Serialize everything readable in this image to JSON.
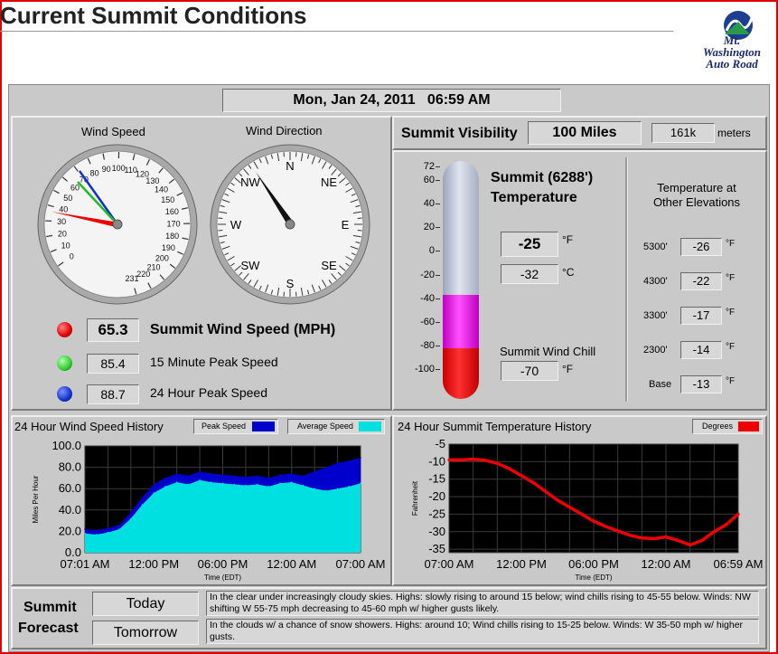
{
  "page_title": "Current Summit Conditions",
  "logo": {
    "line1": "Mt.",
    "line2": "Washington",
    "line3": "Auto Road"
  },
  "datetime": "Mon, Jan 24, 2011   06:59 AM",
  "gauges": {
    "wind_speed_title": "Wind Speed",
    "wind_direction_title": "Wind Direction",
    "speed_ticks": [
      "0",
      "10",
      "20",
      "30",
      "40",
      "50",
      "60",
      "70",
      "80",
      "90",
      "100",
      "110",
      "120",
      "130",
      "140",
      "150",
      "160",
      "170",
      "180",
      "190",
      "200",
      "210",
      "220",
      "231"
    ],
    "direction_labels": [
      "N",
      "NE",
      "E",
      "SE",
      "S",
      "SW",
      "W",
      "NW"
    ]
  },
  "wind": {
    "summit_value": "65.3",
    "summit_label": "Summit Wind Speed (MPH)",
    "peak15_value": "85.4",
    "peak15_label": "15 Minute Peak Speed",
    "peak24_value": "88.7",
    "peak24_label": "24 Hour Peak Speed",
    "led_colors": {
      "summit": "#e00000",
      "peak15": "#33cc33",
      "peak24": "#1133cc"
    }
  },
  "visibility": {
    "label": "Summit Visibility",
    "miles": "100 Miles",
    "meters_value": "161k",
    "meters_unit": "meters"
  },
  "temperature": {
    "title_line1": "Summit (6288')",
    "title_line2": "Temperature",
    "fahrenheit": "-25",
    "f_unit": "°F",
    "celsius": "-32",
    "c_unit": "°C",
    "scale": [
      "72",
      "60",
      "40",
      "20",
      "0",
      "-20",
      "-40",
      "-60",
      "-80",
      "-100"
    ],
    "wind_chill_label": "Summit Wind Chill",
    "wind_chill_value": "-70",
    "wind_chill_unit": "°F"
  },
  "elevations": {
    "title_line1": "Temperature at",
    "title_line2": "Other Elevations",
    "rows": [
      {
        "label": "5300'",
        "value": "-26",
        "unit": "°F"
      },
      {
        "label": "4300'",
        "value": "-22",
        "unit": "°F"
      },
      {
        "label": "3300'",
        "value": "-17",
        "unit": "°F"
      },
      {
        "label": "2300'",
        "value": "-14",
        "unit": "°F"
      },
      {
        "label": "Base",
        "value": "-13",
        "unit": "°F"
      }
    ]
  },
  "wind_history": {
    "title": "24 Hour Wind Speed History",
    "legend_peak": "Peak Speed",
    "legend_avg": "Average Speed"
  },
  "temp_history": {
    "title": "24 Hour Summit Temperature History",
    "legend": "Degrees"
  },
  "forecast": {
    "label_line1": "Summit",
    "label_line2": "Forecast",
    "today_label": "Today",
    "tomorrow_label": "Tomorrow",
    "today_text": "In the clear under increasingly cloudy skies.  Highs: slowly rising to around 15 below; wind chills rising to 45-55 below.  Winds: NW shifting W 55-75 mph decreasing to 45-60 mph w/ higher gusts likely.",
    "tomorrow_text": "In the clouds w/ a chance of snow showers.  Highs: around 10; Wind chills rising to 15-25 below.  Winds: W 35-50 mph w/ higher gusts."
  },
  "chart_data": [
    {
      "type": "area",
      "title": "24 Hour Wind Speed History",
      "xlabel": "Time (EDT)",
      "ylabel": "Miles Per Hour",
      "x_ticks": [
        "07:01 AM",
        "12:00 PM",
        "06:00 PM",
        "12:00 AM",
        "07:00 AM"
      ],
      "y_ticks": [
        "0.0",
        "20.0",
        "40.0",
        "60.0",
        "80.0",
        "100.0"
      ],
      "ylim": [
        0,
        100
      ],
      "x_hours": [
        0,
        1,
        2,
        3,
        4,
        5,
        6,
        7,
        8,
        9,
        10,
        11,
        12,
        13,
        14,
        15,
        16,
        17,
        18,
        19,
        20,
        21,
        22,
        23,
        24
      ],
      "series": [
        {
          "name": "Peak Speed",
          "color": "#0000cc",
          "values": [
            22,
            21,
            23,
            26,
            38,
            52,
            64,
            70,
            74,
            72,
            76,
            74,
            73,
            72,
            71,
            72,
            70,
            73,
            74,
            72,
            76,
            80,
            84,
            86,
            89
          ]
        },
        {
          "name": "Average Speed",
          "color": "#00e0e0",
          "values": [
            18,
            17,
            19,
            22,
            32,
            45,
            56,
            62,
            66,
            64,
            68,
            66,
            65,
            64,
            63,
            64,
            62,
            65,
            66,
            63,
            60,
            58,
            60,
            62,
            65
          ]
        }
      ],
      "grid": true,
      "background": "#000000"
    },
    {
      "type": "line",
      "title": "24 Hour Summit Temperature History",
      "xlabel": "Time (EDT)",
      "ylabel": "Fahrenheit",
      "x_ticks": [
        "07:00 AM",
        "12:00 PM",
        "06:00 PM",
        "12:00 AM",
        "06:59 AM"
      ],
      "y_ticks": [
        "-5",
        "-10",
        "-15",
        "-20",
        "-25",
        "-30",
        "-35"
      ],
      "ylim": [
        -36,
        -5
      ],
      "x_hours": [
        0,
        1,
        2,
        3,
        4,
        5,
        6,
        7,
        8,
        9,
        10,
        11,
        12,
        13,
        14,
        15,
        16,
        17,
        18,
        19,
        20,
        21,
        22,
        23,
        24
      ],
      "series": [
        {
          "name": "Degrees",
          "color": "#ee0000",
          "values": [
            -9.5,
            -9.5,
            -9.3,
            -9.6,
            -10.5,
            -12,
            -14,
            -16,
            -18.5,
            -21,
            -23,
            -25,
            -27,
            -28.5,
            -29.8,
            -31,
            -31.8,
            -32,
            -31.5,
            -32.5,
            -33.8,
            -32.5,
            -30,
            -28,
            -25
          ]
        }
      ],
      "grid": true,
      "background": "#000000"
    }
  ]
}
